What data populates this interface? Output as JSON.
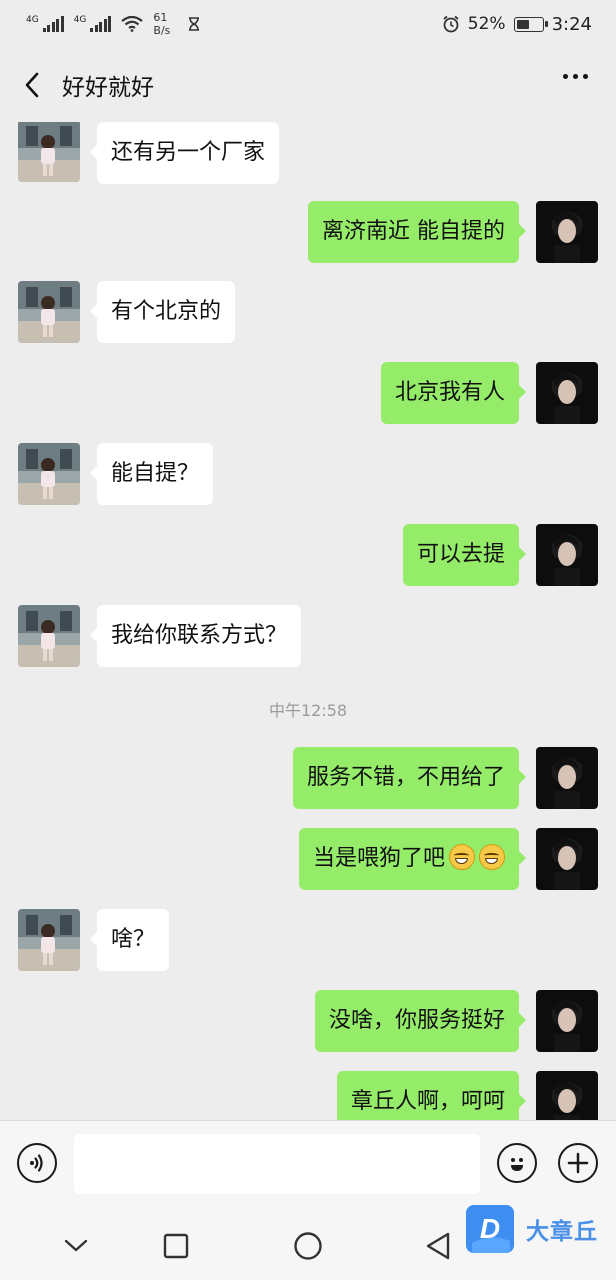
{
  "status_bar": {
    "signal1": "4G",
    "signal2": "4G",
    "netspeed_value": "61",
    "netspeed_unit": "B/s",
    "battery_percent": "52%",
    "battery_level": 0.52,
    "time": "3:24"
  },
  "header": {
    "title": "好好就好"
  },
  "messages": [
    {
      "side": "friend",
      "text": "还有另一个厂家"
    },
    {
      "side": "me",
      "text": "离济南近  能自提的"
    },
    {
      "side": "friend",
      "text": "有个北京的"
    },
    {
      "side": "me",
      "text": "北京我有人"
    },
    {
      "side": "friend",
      "text": "能自提？"
    },
    {
      "side": "me",
      "text": "可以去提"
    },
    {
      "side": "friend",
      "text": "我给你联系方式？"
    },
    {
      "side": "me",
      "text": "服务不错，不用给了"
    },
    {
      "side": "me",
      "text": "当是喂狗了吧"
    },
    {
      "side": "friend",
      "text": "啥？"
    },
    {
      "side": "me",
      "text": "没啥，你服务挺好"
    },
    {
      "side": "me",
      "text": "章丘人啊，呵呵"
    }
  ],
  "timestamp": "中午12:58",
  "watermark": {
    "logo_letter": "D",
    "text": "大章丘"
  }
}
